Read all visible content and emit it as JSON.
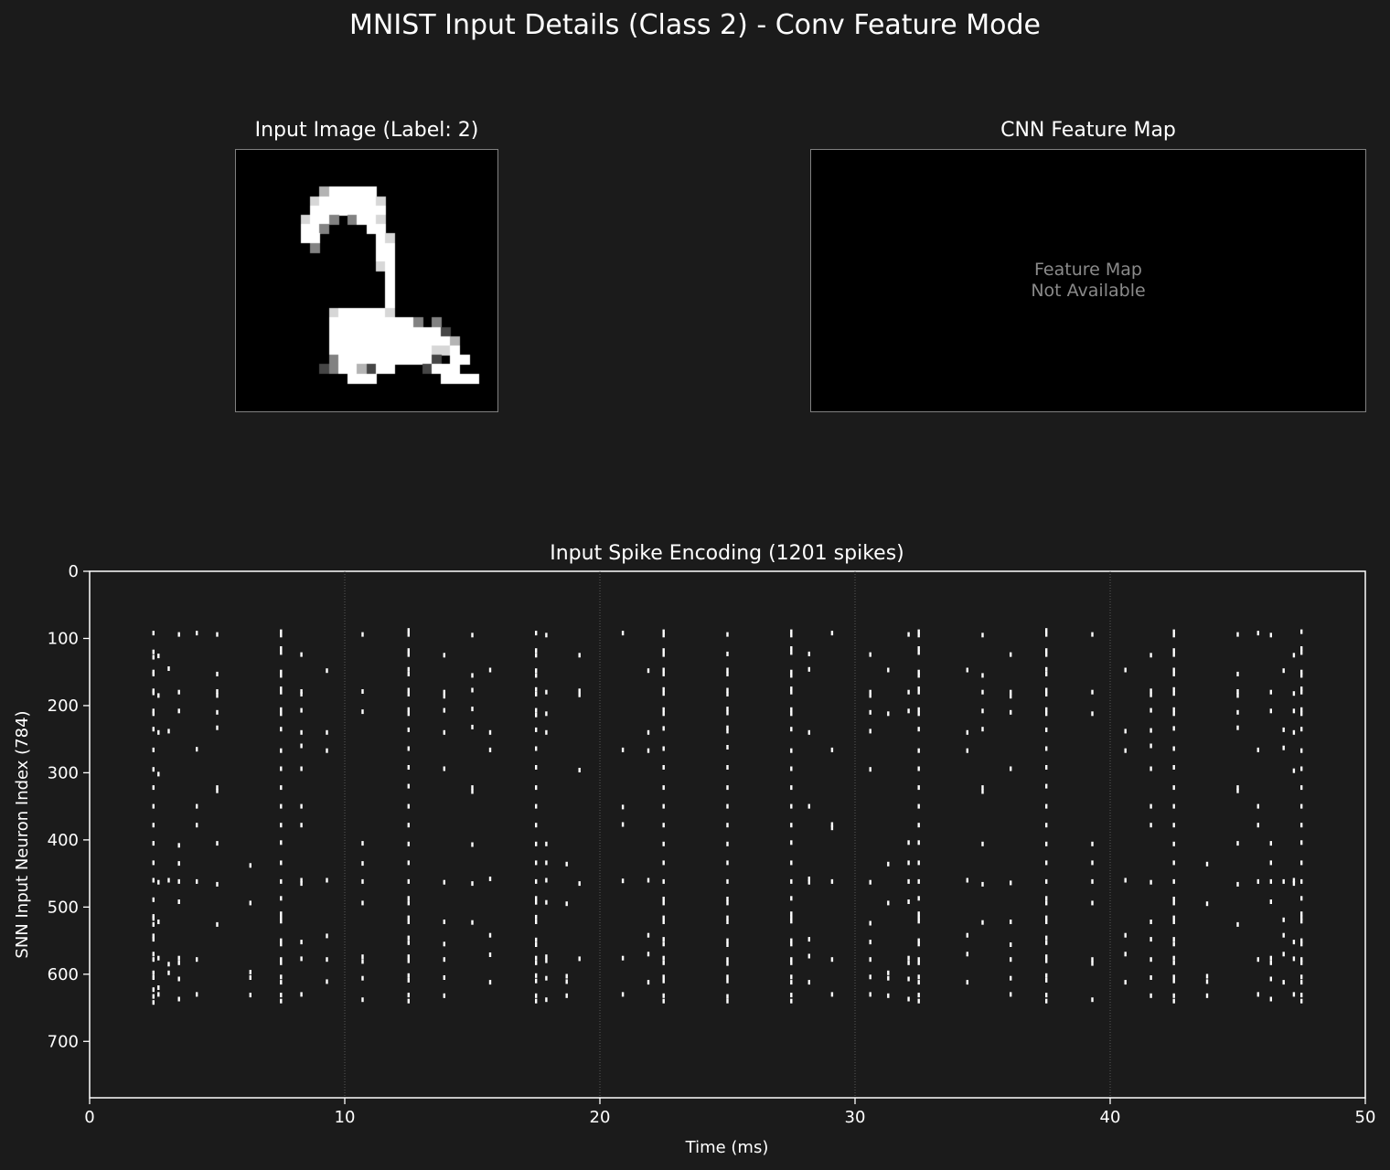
{
  "figure": {
    "title": "MNIST Input Details (Class 2) - Conv Feature Mode"
  },
  "input_image": {
    "title": "Input Image (Label: 2)",
    "label": 2,
    "pixels": [
      "............................",
      "............................",
      "............................",
      "............................",
      ".........=#####.............",
      "........+######+............",
      "........########............",
      ".......+##-.-##+............",
      ".......##-....##............",
      ".......##......#+...........",
      "........-......##...........",
      "...............##...........",
      "...............+#...........",
      "................#...........",
      "................#...........",
      "................#...........",
      "................#...........",
      "..........+#####+...........",
      "..........#########-.-......",
      "..........############:.....",
      "..........#############=....",
      "..........###########++#....",
      "..........-##########:.##...",
      ".........:-##=:##...:###....",
      "............###.......####..",
      "...........................",
      "............................",
      "............................"
    ]
  },
  "feature_map": {
    "title": "CNN Feature Map",
    "line1": "Feature Map",
    "line2": "Not Available"
  },
  "chart_data": {
    "type": "scatter",
    "title": "Input Spike Encoding (1201 spikes)",
    "xlabel": "Time (ms)",
    "ylabel": "SNN Input Neuron Index (784)",
    "xlim": [
      0,
      50
    ],
    "ylim": [
      784,
      0
    ],
    "y_inverted": true,
    "xticks": [
      0,
      10,
      20,
      30,
      40,
      50
    ],
    "yticks": [
      0,
      100,
      200,
      300,
      400,
      500,
      600,
      700
    ],
    "grid": "x-major-dotted",
    "marker_color": "#ffffff",
    "spike_columns": [
      {
        "t": 2.5,
        "neurons": [
          92,
          120,
          128,
          150,
          153,
          178,
          181,
          208,
          212,
          235,
          266,
          295,
          322,
          350,
          378,
          405,
          434,
          460,
          489,
          514,
          517,
          526,
          543,
          548,
          570,
          578,
          598,
          605,
          623,
          633,
          642
        ]
      },
      {
        "t": 2.7,
        "neurons": [
          126,
          185,
          240,
          302,
          463,
          522,
          576,
          620,
          630
        ]
      },
      {
        "t": 3.1,
        "neurons": [
          145,
          238,
          460,
          585,
          598
        ]
      },
      {
        "t": 3.5,
        "neurons": [
          94,
          180,
          208,
          408,
          435,
          462,
          492,
          576,
          583,
          607,
          637
        ]
      },
      {
        "t": 4.2,
        "neurons": [
          92,
          265,
          350,
          378,
          462,
          578,
          630
        ]
      },
      {
        "t": 5.0,
        "neurons": [
          94,
          153,
          179,
          185,
          210,
          233,
          322,
          327,
          405,
          466,
          526
        ]
      },
      {
        "t": 6.3,
        "neurons": [
          438,
          494,
          597,
          605,
          631
        ]
      },
      {
        "t": 7.5,
        "neurons": [
          90,
          95,
          115,
          121,
          150,
          155,
          175,
          180,
          206,
          212,
          235,
          267,
          294,
          322,
          350,
          378,
          404,
          434,
          462,
          487,
          510,
          516,
          521,
          550,
          555,
          578,
          583,
          604,
          612,
          631,
          640
        ]
      },
      {
        "t": 8.3,
        "neurons": [
          124,
          179,
          183,
          207,
          240,
          260,
          294,
          350,
          378,
          460,
          465,
          552,
          577,
          630
        ]
      },
      {
        "t": 9.3,
        "neurons": [
          148,
          240,
          267,
          460,
          543,
          578,
          611
        ]
      },
      {
        "t": 10.7,
        "neurons": [
          94,
          179,
          209,
          405,
          435,
          462,
          494,
          574,
          581,
          606,
          638
        ]
      },
      {
        "t": 12.5,
        "neurons": [
          88,
          94,
          118,
          124,
          146,
          153,
          177,
          183,
          206,
          212,
          236,
          264,
          292,
          320,
          350,
          378,
          406,
          434,
          462,
          487,
          494,
          516,
          522,
          546,
          553,
          574,
          580,
          602,
          609,
          631,
          640
        ]
      },
      {
        "t": 13.9,
        "neurons": [
          125,
          180,
          186,
          207,
          240,
          294,
          463,
          522,
          555,
          578,
          605,
          632
        ]
      },
      {
        "t": 15.0,
        "neurons": [
          95,
          155,
          177,
          205,
          232,
          322,
          328,
          407,
          465,
          523
        ]
      },
      {
        "t": 15.7,
        "neurons": [
          147,
          240,
          266,
          458,
          542,
          571,
          612
        ]
      },
      {
        "t": 17.5,
        "neurons": [
          92,
          118,
          125,
          148,
          155,
          176,
          183,
          207,
          214,
          236,
          264,
          292,
          322,
          350,
          378,
          406,
          434,
          462,
          487,
          493,
          515,
          522,
          549,
          556,
          576,
          583,
          602,
          610,
          632,
          640
        ]
      },
      {
        "t": 17.9,
        "neurons": [
          95,
          180,
          212,
          240,
          406,
          434,
          460,
          493,
          574,
          580,
          606,
          638
        ]
      },
      {
        "t": 18.7,
        "neurons": [
          436,
          495,
          603,
          611,
          632
        ]
      },
      {
        "t": 19.2,
        "neurons": [
          125,
          178,
          184,
          296,
          465,
          577
        ]
      },
      {
        "t": 20.9,
        "neurons": [
          92,
          266,
          351,
          377,
          461,
          576,
          630
        ]
      },
      {
        "t": 21.9,
        "neurons": [
          148,
          240,
          267,
          460,
          542,
          570,
          612
        ]
      },
      {
        "t": 22.5,
        "neurons": [
          90,
          95,
          118,
          124,
          147,
          153,
          176,
          182,
          206,
          212,
          234,
          264,
          292,
          322,
          350,
          378,
          406,
          434,
          462,
          488,
          494,
          516,
          522,
          548,
          555,
          576,
          583,
          604,
          610,
          632,
          640
        ]
      },
      {
        "t": 25.0,
        "neurons": [
          94,
          123,
          147,
          153,
          177,
          183,
          205,
          211,
          233,
          238,
          262,
          292,
          322,
          350,
          378,
          406,
          434,
          462,
          488,
          494,
          516,
          522,
          550,
          556,
          578,
          584,
          604,
          610,
          633,
          640
        ]
      },
      {
        "t": 27.5,
        "neurons": [
          90,
          95,
          115,
          121,
          150,
          155,
          175,
          180,
          206,
          212,
          235,
          267,
          294,
          322,
          350,
          378,
          404,
          434,
          462,
          487,
          510,
          516,
          521,
          550,
          555,
          578,
          583,
          604,
          612,
          631,
          640
        ]
      },
      {
        "t": 28.2,
        "neurons": [
          123,
          146,
          240,
          350,
          458,
          463,
          548,
          573,
          612
        ]
      },
      {
        "t": 29.1,
        "neurons": [
          92,
          266,
          377,
          382,
          462,
          578,
          630
        ]
      },
      {
        "t": 30.6,
        "neurons": [
          124,
          180,
          185,
          210,
          238,
          295,
          463,
          524,
          552,
          578,
          604,
          630
        ]
      },
      {
        "t": 31.3,
        "neurons": [
          147,
          212,
          436,
          494,
          598,
          606,
          632
        ]
      },
      {
        "t": 32.1,
        "neurons": [
          94,
          180,
          208,
          404,
          434,
          462,
          492,
          576,
          583,
          607,
          637
        ]
      },
      {
        "t": 32.5,
        "neurons": [
          90,
          95,
          115,
          121,
          150,
          155,
          175,
          180,
          206,
          212,
          235,
          267,
          294,
          322,
          350,
          378,
          404,
          434,
          462,
          487,
          510,
          516,
          521,
          550,
          555,
          578,
          583,
          604,
          612,
          631,
          640
        ]
      },
      {
        "t": 34.4,
        "neurons": [
          147,
          240,
          267,
          460,
          542,
          570,
          612
        ]
      },
      {
        "t": 35.0,
        "neurons": [
          95,
          155,
          180,
          208,
          235,
          322,
          328,
          406,
          466,
          523
        ]
      },
      {
        "t": 36.1,
        "neurons": [
          124,
          180,
          186,
          210,
          294,
          464,
          522,
          556,
          578,
          606,
          630
        ]
      },
      {
        "t": 37.5,
        "neurons": [
          88,
          94,
          118,
          124,
          146,
          153,
          177,
          183,
          206,
          212,
          236,
          264,
          292,
          320,
          350,
          378,
          406,
          434,
          462,
          487,
          494,
          516,
          522,
          546,
          553,
          574,
          580,
          602,
          609,
          631,
          640
        ]
      },
      {
        "t": 39.3,
        "neurons": [
          94,
          180,
          212,
          406,
          434,
          462,
          494,
          578,
          584,
          638
        ]
      },
      {
        "t": 40.6,
        "neurons": [
          147,
          238,
          267,
          460,
          542,
          570,
          612
        ]
      },
      {
        "t": 41.6,
        "neurons": [
          125,
          178,
          184,
          207,
          237,
          260,
          294,
          350,
          378,
          463,
          522,
          548,
          578,
          605,
          632
        ]
      },
      {
        "t": 42.5,
        "neurons": [
          90,
          95,
          118,
          124,
          147,
          153,
          176,
          182,
          206,
          212,
          234,
          264,
          292,
          322,
          350,
          378,
          406,
          434,
          462,
          488,
          494,
          516,
          522,
          548,
          555,
          576,
          583,
          604,
          610,
          632,
          640
        ]
      },
      {
        "t": 43.8,
        "neurons": [
          436,
          495,
          603,
          611,
          632
        ]
      },
      {
        "t": 45.0,
        "neurons": [
          94,
          153,
          179,
          185,
          210,
          233,
          322,
          327,
          405,
          466,
          526
        ]
      },
      {
        "t": 45.8,
        "neurons": [
          92,
          266,
          350,
          378,
          462,
          578,
          630
        ]
      },
      {
        "t": 46.3,
        "neurons": [
          95,
          180,
          208,
          405,
          434,
          462,
          492,
          576,
          583,
          607,
          637
        ]
      },
      {
        "t": 46.8,
        "neurons": [
          148,
          236,
          263,
          462,
          519,
          542,
          570,
          612
        ]
      },
      {
        "t": 47.2,
        "neurons": [
          125,
          182,
          208,
          240,
          297,
          460,
          465,
          552,
          577,
          630
        ]
      },
      {
        "t": 47.5,
        "neurons": [
          90,
          115,
          121,
          150,
          155,
          175,
          180,
          206,
          212,
          235,
          267,
          294,
          322,
          350,
          378,
          404,
          434,
          462,
          487,
          510,
          516,
          521,
          550,
          555,
          578,
          583,
          604,
          612,
          631,
          640
        ]
      }
    ]
  }
}
